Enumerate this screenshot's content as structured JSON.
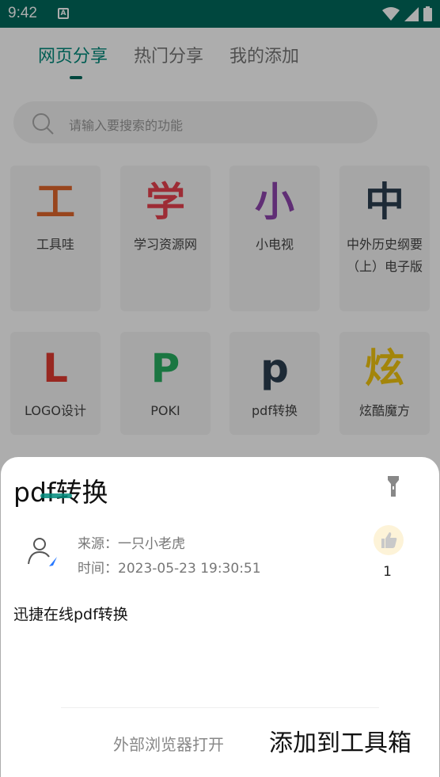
{
  "status_bar": {
    "time": "9:42",
    "a_badge": "A"
  },
  "tabs": [
    {
      "label": "网页分享",
      "active": true
    },
    {
      "label": "热门分享",
      "active": false
    },
    {
      "label": "我的添加",
      "active": false
    }
  ],
  "search": {
    "placeholder": "请输入要搜索的功能"
  },
  "cards": [
    {
      "glyph": "工",
      "label": "工具哇",
      "color": "#e0662b"
    },
    {
      "glyph": "学",
      "label": "学习资源网",
      "color": "#e8424f"
    },
    {
      "glyph": "小",
      "label": "小电视",
      "color": "#8e44ad"
    },
    {
      "glyph": "中",
      "label": "中外历史纲要（上）电子版",
      "color": "#2c3e50"
    },
    {
      "glyph": "L",
      "label": "LOGO设计",
      "color": "#e03c31"
    },
    {
      "glyph": "P",
      "label": "POKI",
      "color": "#27ae60"
    },
    {
      "glyph": "p",
      "label": "pdf转换",
      "color": "#2c3e50"
    },
    {
      "glyph": "炫",
      "label": "炫酷魔方",
      "color": "#f1c40f"
    }
  ],
  "sheet": {
    "title": "pdf转换",
    "source": "来源：一只小老虎",
    "time": "时间：2023-05-23 19:30:51",
    "like_count": "1",
    "description": "迅捷在线pdf转换",
    "open_browser_label": "外部浏览器打开",
    "add_toolbox_label": "添加到工具箱"
  }
}
